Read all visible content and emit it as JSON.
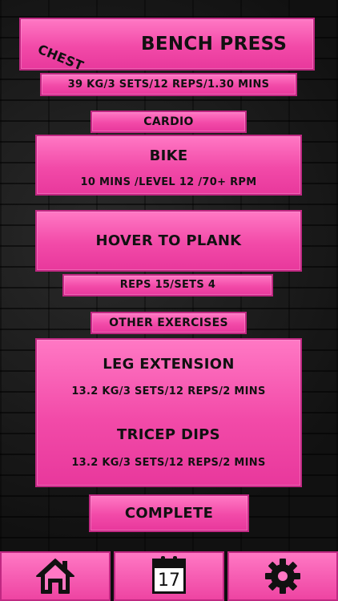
{
  "header": {
    "tag": "CHEST",
    "title": "BENCH PRESS"
  },
  "bench_press_detail": "39 KG/3 SETS/12 REPS/1.30 MINS",
  "cardio_label": "CARDIO",
  "bike": {
    "title": "BIKE",
    "detail": "10 MINS /LEVEL 12 /70+ RPM"
  },
  "hover": {
    "title": "HOVER TO PLANK"
  },
  "reps_detail": "REPS 15/SETS 4",
  "other_label": "OTHER EXERCISES",
  "other_exercises": [
    {
      "title": "LEG EXTENSION",
      "detail": "13.2 KG/3 SETS/12 REPS/2 MINS"
    },
    {
      "title": "TRICEP DIPS",
      "detail": "13.2 KG/3 SETS/12 REPS/2 MINS"
    }
  ],
  "complete_label": "COMPLETE",
  "tabbar": {
    "calendar_day": "17",
    "icons": [
      "home-icon",
      "calendar-icon",
      "gear-icon"
    ]
  },
  "colors": {
    "accent": "#f24aa8",
    "border": "#c02882",
    "text": "#111111"
  }
}
